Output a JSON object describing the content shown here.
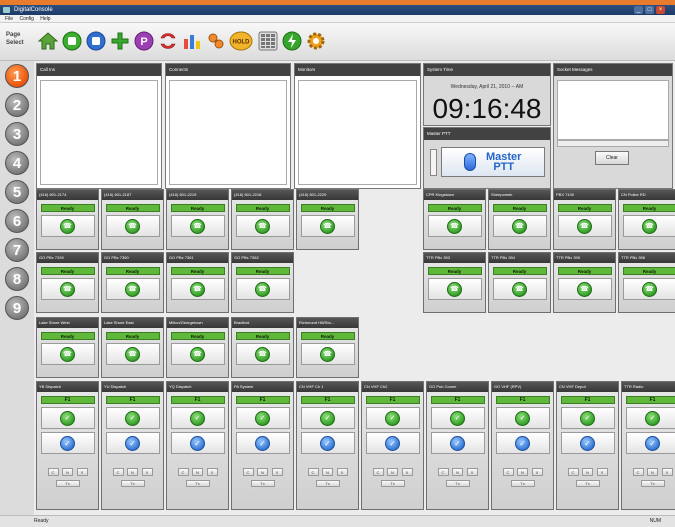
{
  "window": {
    "title": "DigitalConsole"
  },
  "menu": [
    "File",
    "Config",
    "Help"
  ],
  "page_select_label": "Page Select",
  "pages": [
    "1",
    "2",
    "3",
    "4",
    "5",
    "6",
    "7",
    "8",
    "9"
  ],
  "toolbar_hold_label": "HOLD",
  "panels": {
    "call_ins": "Call Ins",
    "connects": "Connects",
    "monitors": "Monitors",
    "system_time": "System Time",
    "socket_messages": "Socket Messages",
    "master_ptt": "Master PTT"
  },
  "clock": {
    "date": "Wednesday, April 21, 2010 -- AM",
    "time": "09:16:48"
  },
  "master_button": {
    "line1": "Master",
    "line2": "PTT"
  },
  "clear_label": "Clear",
  "ready_label": "Ready",
  "f1_label": "F1",
  "mini": [
    "C",
    "N",
    "X"
  ],
  "xfer_label": "Tx",
  "phone_row1_left": [
    "(416) 601-2174",
    "(416) 601-2187",
    "(416) 601-2219",
    "(416) 601-2218",
    "(416) 601-2229"
  ],
  "phone_row1_right": [
    "CPR Kingstown",
    "Sheepcreek",
    "PBX 7100",
    "CN Police RD"
  ],
  "phone_row2_left": [
    "GO PBx 7339",
    "GO PBx 7360",
    "GO PBx 7361",
    "GO PBx 7362"
  ],
  "phone_row2_right": [
    "TTR PBx 393",
    "TTR PBx 394",
    "TTR PBx 395",
    "TTR PBx 396"
  ],
  "phone_row3": [
    "Lake Shore West",
    "Lake Shore East",
    "Milton/Georgetown",
    "Bradford",
    "Richmond Hill/Sto..."
  ],
  "radios": [
    "YB Dispatch",
    "YU Dispatch",
    "YQ Dispatch",
    "PA System",
    "CN VHF Ch 1",
    "CN VHF Ch2",
    "GO Pub Comm",
    "GO VHF (RPV)",
    "CN VHF Depot",
    "TTR Radio"
  ],
  "status": {
    "text": "Ready",
    "right": "NUM"
  }
}
